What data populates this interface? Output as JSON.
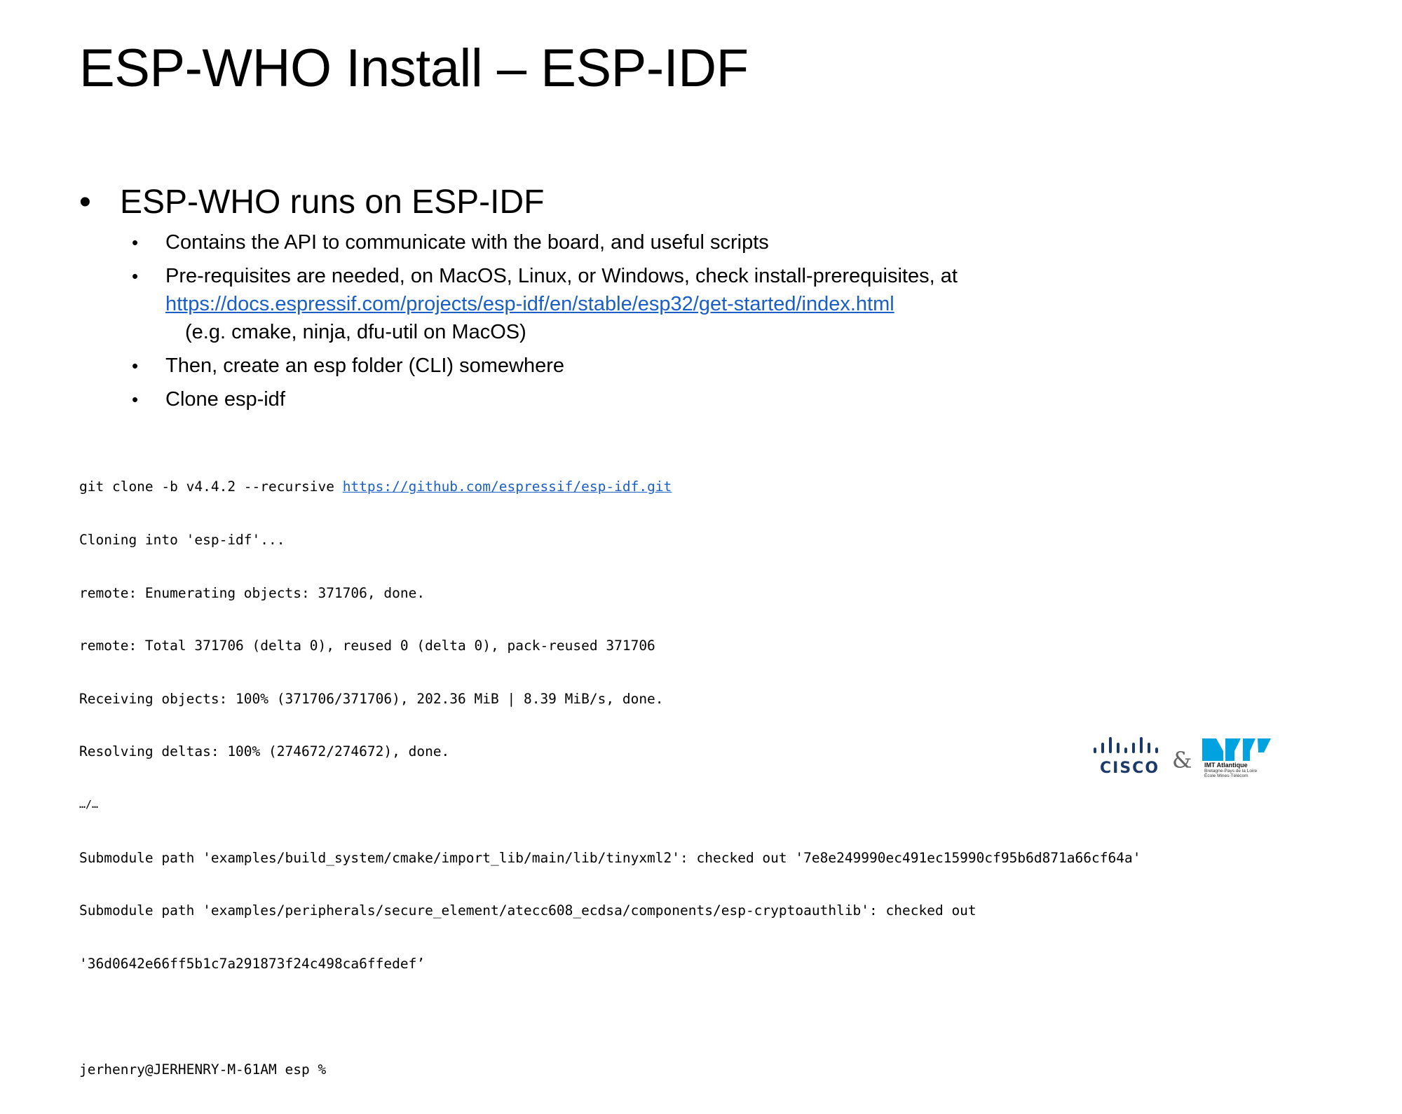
{
  "slide": {
    "title": "ESP-WHO Install – ESP-IDF",
    "main_bullet": "ESP-WHO runs on ESP-IDF",
    "sub_bullets": {
      "b1": "Contains the API to communicate with the board, and useful scripts",
      "b2_text": "Pre-requisites are needed, on MacOS, Linux, or Windows, check install-prerequisites, at",
      "b2_link": "https://docs.espressif.com/projects/esp-idf/en/stable/esp32/get-started/index.html",
      "b2_note": "(e.g. cmake, ninja, dfu-util on MacOS)",
      "b3": "Then, create an esp folder (CLI) somewhere",
      "b4": "Clone esp-idf"
    }
  },
  "terminal": {
    "cmd_prefix": "git clone -b v4.4.2 --recursive ",
    "cmd_link": "https://github.com/espressif/esp-idf.git",
    "lines": [
      "Cloning into 'esp-idf'...",
      "remote: Enumerating objects: 371706, done.",
      "remote: Total 371706 (delta 0), reused 0 (delta 0), pack-reused 371706",
      "Receiving objects: 100% (371706/371706), 202.36 MiB | 8.39 MiB/s, done.",
      "Resolving deltas: 100% (274672/274672), done."
    ],
    "ellipsis": "…/…",
    "submodule_lines": [
      "Submodule path 'examples/build_system/cmake/import_lib/main/lib/tinyxml2': checked out '7e8e249990ec491ec15990cf95b6d871a66cf64a'",
      "Submodule path 'examples/peripherals/secure_element/atecc608_ecdsa/components/esp-cryptoauthlib': checked out",
      "'36d0642e66ff5b1c7a291873f24c498ca6ffedef’"
    ],
    "prompt": "jerhenry@JERHENRY-M-61AM esp %"
  },
  "footer": {
    "cisco_logo_text": "CISCO",
    "ampersand": "&",
    "imt_name": "IMT Atlantique",
    "imt_sub1": "Bretagne-Pays de la Loire",
    "imt_sub2": "École Mines-Télécom",
    "colors": {
      "cisco": "#1b3a6b",
      "imt": "#00a3e0",
      "link": "#1a5fc8"
    }
  }
}
